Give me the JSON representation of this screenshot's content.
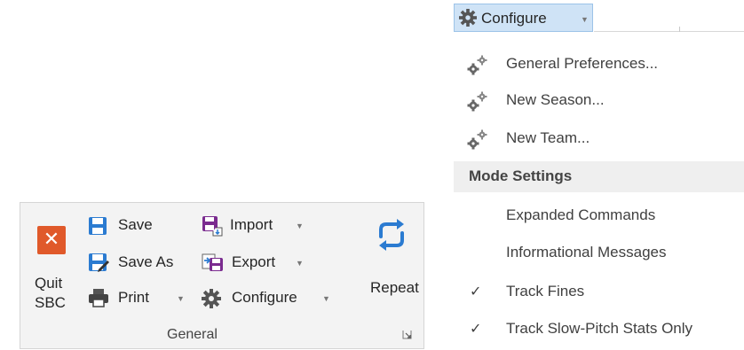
{
  "ribbon": {
    "quit_label": "Quit SBC",
    "quit_line1": "Quit",
    "quit_line2": "SBC",
    "save_label": "Save",
    "save_as_label": "Save As",
    "print_label": "Print",
    "import_label": "Import",
    "export_label": "Export",
    "configure_label": "Configure",
    "repeat_label": "Repeat",
    "group_label": "General"
  },
  "menu": {
    "button_label": "Configure",
    "items": [
      {
        "label": "General Preferences...",
        "icon": "gears-icon"
      },
      {
        "label": "New Season...",
        "icon": "gears-icon"
      },
      {
        "label": "New Team...",
        "icon": "gears-icon"
      }
    ],
    "section_title": "Mode Settings",
    "options": [
      {
        "label": "Expanded Commands",
        "checked": false
      },
      {
        "label": "Informational Messages",
        "checked": false
      },
      {
        "label": "Track Fines",
        "checked": true
      },
      {
        "label": "Track Slow-Pitch Stats Only",
        "checked": true
      }
    ],
    "check_glyph": "✓"
  },
  "colors": {
    "quit_bg": "#e0592a",
    "accent_blue": "#2b7bd1",
    "menu_button_bg": "#cfe3f6",
    "gear_gray": "#555555"
  }
}
